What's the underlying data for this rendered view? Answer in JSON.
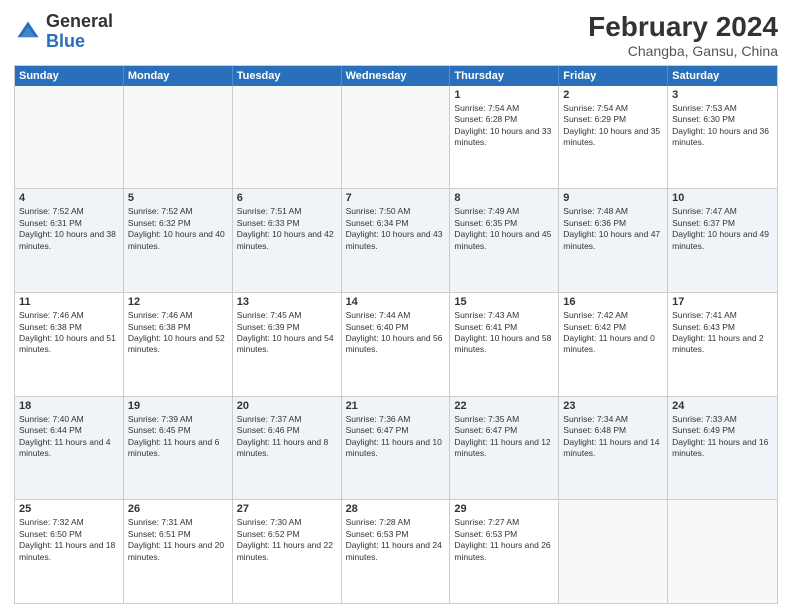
{
  "logo": {
    "general": "General",
    "blue": "Blue"
  },
  "title": {
    "month_year": "February 2024",
    "location": "Changba, Gansu, China"
  },
  "days_of_week": [
    "Sunday",
    "Monday",
    "Tuesday",
    "Wednesday",
    "Thursday",
    "Friday",
    "Saturday"
  ],
  "weeks": [
    {
      "cells": [
        {
          "day": "",
          "empty": true
        },
        {
          "day": "",
          "empty": true
        },
        {
          "day": "",
          "empty": true
        },
        {
          "day": "",
          "empty": true
        },
        {
          "day": "1",
          "sunrise": "Sunrise: 7:54 AM",
          "sunset": "Sunset: 6:28 PM",
          "daylight": "Daylight: 10 hours and 33 minutes."
        },
        {
          "day": "2",
          "sunrise": "Sunrise: 7:54 AM",
          "sunset": "Sunset: 6:29 PM",
          "daylight": "Daylight: 10 hours and 35 minutes."
        },
        {
          "day": "3",
          "sunrise": "Sunrise: 7:53 AM",
          "sunset": "Sunset: 6:30 PM",
          "daylight": "Daylight: 10 hours and 36 minutes."
        }
      ]
    },
    {
      "cells": [
        {
          "day": "4",
          "sunrise": "Sunrise: 7:52 AM",
          "sunset": "Sunset: 6:31 PM",
          "daylight": "Daylight: 10 hours and 38 minutes."
        },
        {
          "day": "5",
          "sunrise": "Sunrise: 7:52 AM",
          "sunset": "Sunset: 6:32 PM",
          "daylight": "Daylight: 10 hours and 40 minutes."
        },
        {
          "day": "6",
          "sunrise": "Sunrise: 7:51 AM",
          "sunset": "Sunset: 6:33 PM",
          "daylight": "Daylight: 10 hours and 42 minutes."
        },
        {
          "day": "7",
          "sunrise": "Sunrise: 7:50 AM",
          "sunset": "Sunset: 6:34 PM",
          "daylight": "Daylight: 10 hours and 43 minutes."
        },
        {
          "day": "8",
          "sunrise": "Sunrise: 7:49 AM",
          "sunset": "Sunset: 6:35 PM",
          "daylight": "Daylight: 10 hours and 45 minutes."
        },
        {
          "day": "9",
          "sunrise": "Sunrise: 7:48 AM",
          "sunset": "Sunset: 6:36 PM",
          "daylight": "Daylight: 10 hours and 47 minutes."
        },
        {
          "day": "10",
          "sunrise": "Sunrise: 7:47 AM",
          "sunset": "Sunset: 6:37 PM",
          "daylight": "Daylight: 10 hours and 49 minutes."
        }
      ]
    },
    {
      "cells": [
        {
          "day": "11",
          "sunrise": "Sunrise: 7:46 AM",
          "sunset": "Sunset: 6:38 PM",
          "daylight": "Daylight: 10 hours and 51 minutes."
        },
        {
          "day": "12",
          "sunrise": "Sunrise: 7:46 AM",
          "sunset": "Sunset: 6:38 PM",
          "daylight": "Daylight: 10 hours and 52 minutes."
        },
        {
          "day": "13",
          "sunrise": "Sunrise: 7:45 AM",
          "sunset": "Sunset: 6:39 PM",
          "daylight": "Daylight: 10 hours and 54 minutes."
        },
        {
          "day": "14",
          "sunrise": "Sunrise: 7:44 AM",
          "sunset": "Sunset: 6:40 PM",
          "daylight": "Daylight: 10 hours and 56 minutes."
        },
        {
          "day": "15",
          "sunrise": "Sunrise: 7:43 AM",
          "sunset": "Sunset: 6:41 PM",
          "daylight": "Daylight: 10 hours and 58 minutes."
        },
        {
          "day": "16",
          "sunrise": "Sunrise: 7:42 AM",
          "sunset": "Sunset: 6:42 PM",
          "daylight": "Daylight: 11 hours and 0 minutes."
        },
        {
          "day": "17",
          "sunrise": "Sunrise: 7:41 AM",
          "sunset": "Sunset: 6:43 PM",
          "daylight": "Daylight: 11 hours and 2 minutes."
        }
      ]
    },
    {
      "cells": [
        {
          "day": "18",
          "sunrise": "Sunrise: 7:40 AM",
          "sunset": "Sunset: 6:44 PM",
          "daylight": "Daylight: 11 hours and 4 minutes."
        },
        {
          "day": "19",
          "sunrise": "Sunrise: 7:39 AM",
          "sunset": "Sunset: 6:45 PM",
          "daylight": "Daylight: 11 hours and 6 minutes."
        },
        {
          "day": "20",
          "sunrise": "Sunrise: 7:37 AM",
          "sunset": "Sunset: 6:46 PM",
          "daylight": "Daylight: 11 hours and 8 minutes."
        },
        {
          "day": "21",
          "sunrise": "Sunrise: 7:36 AM",
          "sunset": "Sunset: 6:47 PM",
          "daylight": "Daylight: 11 hours and 10 minutes."
        },
        {
          "day": "22",
          "sunrise": "Sunrise: 7:35 AM",
          "sunset": "Sunset: 6:47 PM",
          "daylight": "Daylight: 11 hours and 12 minutes."
        },
        {
          "day": "23",
          "sunrise": "Sunrise: 7:34 AM",
          "sunset": "Sunset: 6:48 PM",
          "daylight": "Daylight: 11 hours and 14 minutes."
        },
        {
          "day": "24",
          "sunrise": "Sunrise: 7:33 AM",
          "sunset": "Sunset: 6:49 PM",
          "daylight": "Daylight: 11 hours and 16 minutes."
        }
      ]
    },
    {
      "cells": [
        {
          "day": "25",
          "sunrise": "Sunrise: 7:32 AM",
          "sunset": "Sunset: 6:50 PM",
          "daylight": "Daylight: 11 hours and 18 minutes."
        },
        {
          "day": "26",
          "sunrise": "Sunrise: 7:31 AM",
          "sunset": "Sunset: 6:51 PM",
          "daylight": "Daylight: 11 hours and 20 minutes."
        },
        {
          "day": "27",
          "sunrise": "Sunrise: 7:30 AM",
          "sunset": "Sunset: 6:52 PM",
          "daylight": "Daylight: 11 hours and 22 minutes."
        },
        {
          "day": "28",
          "sunrise": "Sunrise: 7:28 AM",
          "sunset": "Sunset: 6:53 PM",
          "daylight": "Daylight: 11 hours and 24 minutes."
        },
        {
          "day": "29",
          "sunrise": "Sunrise: 7:27 AM",
          "sunset": "Sunset: 6:53 PM",
          "daylight": "Daylight: 11 hours and 26 minutes."
        },
        {
          "day": "",
          "empty": true
        },
        {
          "day": "",
          "empty": true
        }
      ]
    }
  ]
}
